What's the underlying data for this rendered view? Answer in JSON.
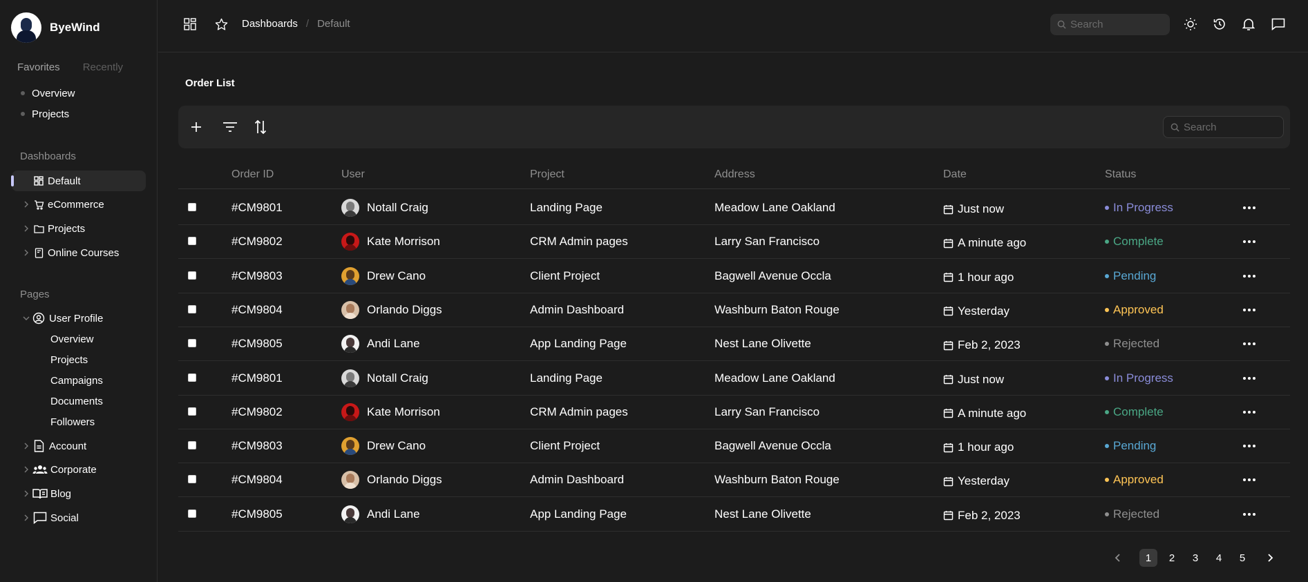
{
  "brand": {
    "name": "ByeWind"
  },
  "favorites": {
    "tabs": [
      "Favorites",
      "Recently"
    ],
    "items": [
      "Overview",
      "Projects"
    ]
  },
  "dashboards": {
    "label": "Dashboards",
    "items": [
      "Default",
      "eCommerce",
      "Projects",
      "Online Courses"
    ]
  },
  "pages": {
    "label": "Pages",
    "user_profile": "User Profile",
    "user_profile_sub": [
      "Overview",
      "Projects",
      "Campaigns",
      "Documents",
      "Followers"
    ],
    "others": [
      "Account",
      "Corporate",
      "Blog",
      "Social"
    ]
  },
  "header": {
    "breadcrumb": [
      "Dashboards",
      "Default"
    ],
    "breadcrumb_sep": "/",
    "search_placeholder": "Search"
  },
  "main": {
    "title": "Order List",
    "search_placeholder": "Search",
    "columns": [
      "Order ID",
      "User",
      "Project",
      "Address",
      "Date",
      "Status"
    ],
    "rows": [
      {
        "id": "#CM9801",
        "user": "Notall Craig",
        "project": "Landing Page",
        "address": "Meadow Lane Oakland",
        "date": "Just now",
        "status": "In Progress"
      },
      {
        "id": "#CM9802",
        "user": "Kate Morrison",
        "project": "CRM Admin pages",
        "address": "Larry San Francisco",
        "date": "A minute ago",
        "status": "Complete"
      },
      {
        "id": "#CM9803",
        "user": "Drew Cano",
        "project": "Client Project",
        "address": "Bagwell Avenue Occla",
        "date": "1 hour ago",
        "status": "Pending"
      },
      {
        "id": "#CM9804",
        "user": "Orlando Diggs",
        "project": "Admin Dashboard",
        "address": "Washburn Baton Rouge",
        "date": "Yesterday",
        "status": "Approved"
      },
      {
        "id": "#CM9805",
        "user": "Andi Lane",
        "project": "App Landing Page",
        "address": "Nest Lane Olivette",
        "date": "Feb 2, 2023",
        "status": "Rejected"
      },
      {
        "id": "#CM9801",
        "user": "Notall Craig",
        "project": "Landing Page",
        "address": "Meadow Lane Oakland",
        "date": "Just now",
        "status": "In Progress"
      },
      {
        "id": "#CM9802",
        "user": "Kate Morrison",
        "project": "CRM Admin pages",
        "address": "Larry San Francisco",
        "date": "A minute ago",
        "status": "Complete"
      },
      {
        "id": "#CM9803",
        "user": "Drew Cano",
        "project": "Client Project",
        "address": "Bagwell Avenue Occla",
        "date": "1 hour ago",
        "status": "Pending"
      },
      {
        "id": "#CM9804",
        "user": "Orlando Diggs",
        "project": "Admin Dashboard",
        "address": "Washburn Baton Rouge",
        "date": "Yesterday",
        "status": "Approved"
      },
      {
        "id": "#CM9805",
        "user": "Andi Lane",
        "project": "App Landing Page",
        "address": "Nest Lane Olivette",
        "date": "Feb 2, 2023",
        "status": "Rejected"
      }
    ]
  },
  "status_colors": {
    "In Progress": "#8a8cd9",
    "Complete": "#4aa785",
    "Pending": "#59a8d4",
    "Approved": "#ffc555",
    "Rejected": "#8f8f8f"
  },
  "pagination": {
    "pages": [
      "1",
      "2",
      "3",
      "4",
      "5"
    ],
    "current": "1"
  }
}
